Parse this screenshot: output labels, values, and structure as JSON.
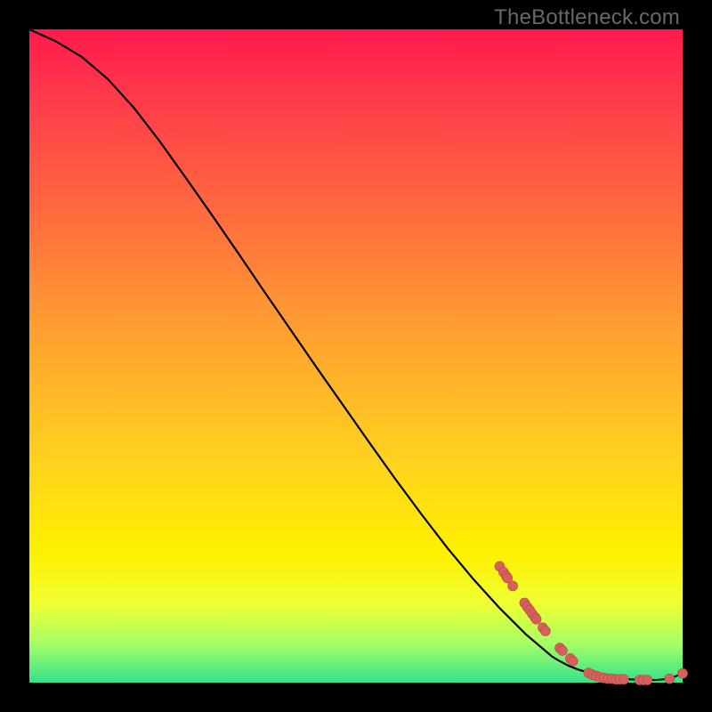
{
  "watermark": "TheBottleneck.com",
  "colors": {
    "curve": "#000000",
    "point_fill": "#d6605b",
    "point_stroke": "#b74b46",
    "bg_top": "#ff1a4d",
    "bg_mid": "#fff000",
    "bg_bottom": "#33e28c",
    "frame": "#000000"
  },
  "chart_data": {
    "type": "line",
    "title": "",
    "xlabel": "",
    "ylabel": "",
    "xlim": [
      0,
      100
    ],
    "ylim": [
      0,
      100
    ],
    "curve": {
      "x": [
        0,
        4,
        8,
        12,
        16,
        20,
        24,
        28,
        32,
        36,
        40,
        44,
        48,
        52,
        56,
        60,
        64,
        68,
        72,
        76,
        80,
        81,
        82.5,
        84,
        86,
        88,
        90,
        92,
        94,
        96,
        98,
        100
      ],
      "y": [
        100,
        98.2,
        95.8,
        92.4,
        88.0,
        82.8,
        77.2,
        71.5,
        65.7,
        59.8,
        54.0,
        48.2,
        42.5,
        36.8,
        31.2,
        25.8,
        20.6,
        15.8,
        11.4,
        7.4,
        4.0,
        3.4,
        2.6,
        2.0,
        1.4,
        1.0,
        0.7,
        0.5,
        0.4,
        0.4,
        0.6,
        1.4
      ]
    },
    "points": [
      {
        "x": 72.0,
        "y": 17.8
      },
      {
        "x": 72.6,
        "y": 16.9
      },
      {
        "x": 73.0,
        "y": 16.3
      },
      {
        "x": 73.2,
        "y": 16.0
      },
      {
        "x": 74.0,
        "y": 14.8
      },
      {
        "x": 75.8,
        "y": 12.2
      },
      {
        "x": 76.2,
        "y": 11.6
      },
      {
        "x": 76.6,
        "y": 11.1
      },
      {
        "x": 77.0,
        "y": 10.5
      },
      {
        "x": 77.4,
        "y": 10.0
      },
      {
        "x": 77.6,
        "y": 9.7
      },
      {
        "x": 78.6,
        "y": 8.4
      },
      {
        "x": 79.0,
        "y": 7.9
      },
      {
        "x": 81.2,
        "y": 5.3
      },
      {
        "x": 81.6,
        "y": 4.9
      },
      {
        "x": 82.8,
        "y": 3.7
      },
      {
        "x": 83.2,
        "y": 3.3
      },
      {
        "x": 85.6,
        "y": 1.5
      },
      {
        "x": 86.2,
        "y": 1.2
      },
      {
        "x": 86.8,
        "y": 1.0
      },
      {
        "x": 87.4,
        "y": 0.8
      },
      {
        "x": 88.0,
        "y": 0.7
      },
      {
        "x": 88.6,
        "y": 0.6
      },
      {
        "x": 89.2,
        "y": 0.6
      },
      {
        "x": 89.8,
        "y": 0.5
      },
      {
        "x": 90.4,
        "y": 0.5
      },
      {
        "x": 91.0,
        "y": 0.5
      },
      {
        "x": 93.4,
        "y": 0.4
      },
      {
        "x": 94.0,
        "y": 0.4
      },
      {
        "x": 94.6,
        "y": 0.4
      },
      {
        "x": 98.0,
        "y": 0.6
      },
      {
        "x": 100.0,
        "y": 1.4
      }
    ]
  }
}
